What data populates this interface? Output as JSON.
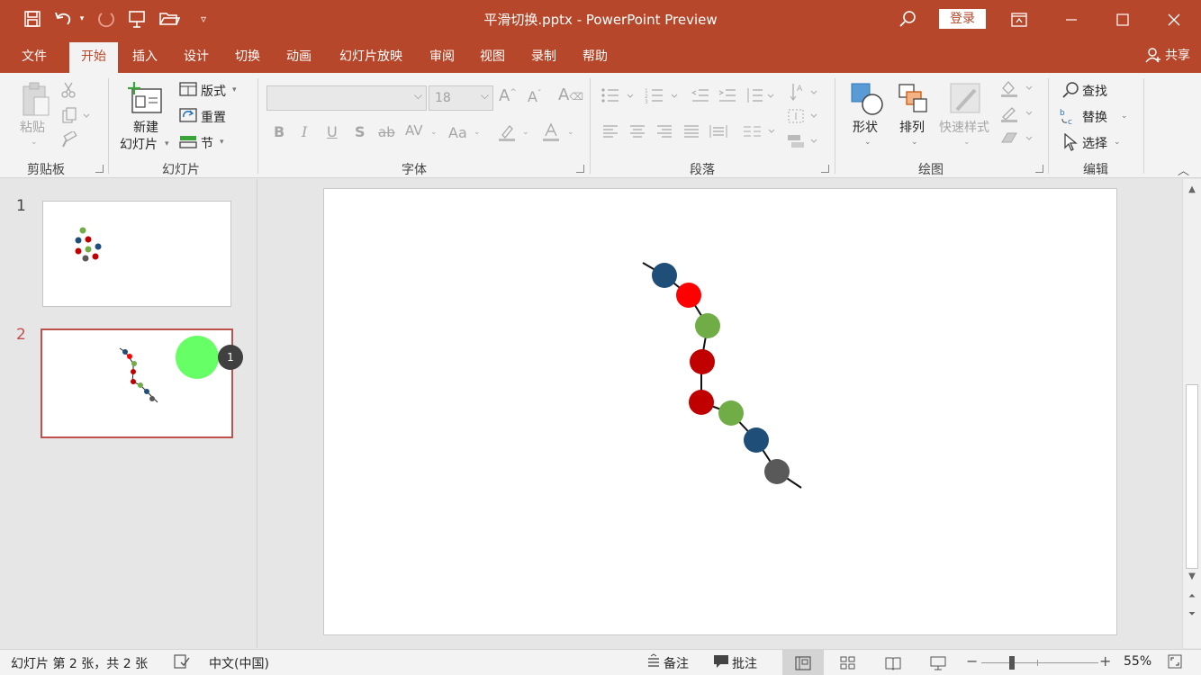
{
  "title_bar": {
    "document_title": "平滑切换.pptx  -  PowerPoint Preview",
    "signin_label": "登录",
    "quick_access_icons": [
      "save-icon",
      "undo-icon",
      "redo-icon",
      "present-from-start-icon",
      "open-folder-icon",
      "customize-qat-icon"
    ]
  },
  "tabs": [
    {
      "label": "文件",
      "active": false
    },
    {
      "label": "开始",
      "active": true
    },
    {
      "label": "插入",
      "active": false
    },
    {
      "label": "设计",
      "active": false
    },
    {
      "label": "切换",
      "active": false
    },
    {
      "label": "动画",
      "active": false
    },
    {
      "label": "幻灯片放映",
      "active": false
    },
    {
      "label": "审阅",
      "active": false
    },
    {
      "label": "视图",
      "active": false
    },
    {
      "label": "录制",
      "active": false
    },
    {
      "label": "帮助",
      "active": false
    }
  ],
  "share_label": "共享",
  "ribbon": {
    "clipboard": {
      "paste_label": "粘贴",
      "group_label": "剪贴板"
    },
    "slides": {
      "new_slide_label_1": "新建",
      "new_slide_label_2": "幻灯片",
      "layout_label": "版式",
      "reset_label": "重置",
      "section_label": "节",
      "group_label": "幻灯片"
    },
    "font": {
      "font_name": "",
      "font_size": "18",
      "bold": "B",
      "italic": "I",
      "underline": "U",
      "shadow": "S",
      "strike": "ab",
      "spacing": "AV",
      "case": "Aa",
      "group_label": "字体"
    },
    "paragraph": {
      "group_label": "段落"
    },
    "drawing": {
      "shapes_label": "形状",
      "arrange_label": "排列",
      "quick_styles_label": "快速样式",
      "group_label": "绘图"
    },
    "editing": {
      "find_label": "查找",
      "replace_label": "替换",
      "select_label": "选择",
      "group_label": "编辑"
    }
  },
  "slides": [
    {
      "number": "1",
      "selected": false
    },
    {
      "number": "2",
      "selected": true,
      "badge": "1"
    }
  ],
  "slide_content": {
    "beads": [
      {
        "color": "#1f4e79"
      },
      {
        "color": "#ff0000"
      },
      {
        "color": "#70ad47"
      },
      {
        "color": "#c00000"
      },
      {
        "color": "#c00000"
      },
      {
        "color": "#70ad47"
      },
      {
        "color": "#1f4e79"
      },
      {
        "color": "#595959"
      }
    ]
  },
  "status_bar": {
    "slide_info": "幻灯片 第 2 张，共 2 张",
    "language": "中文(中国)",
    "notes_label": "备注",
    "comments_label": "批注",
    "zoom": "55%"
  },
  "colors": {
    "accent": "#b7472a",
    "thumb_selected_border": "#c0504d",
    "green_shape": "#66ff66"
  }
}
